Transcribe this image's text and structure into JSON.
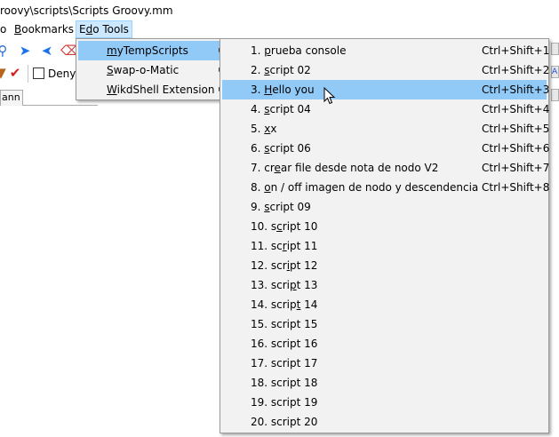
{
  "window": {
    "title": "roovy\\scripts\\Scripts Groovy.mm"
  },
  "menubar": {
    "items": [
      {
        "label": "o"
      },
      {
        "label": "Bookmarks",
        "mnemonic": "B",
        "rest": "ookmarks"
      },
      {
        "label": "Edo Tools",
        "pre": "E",
        "mnemonic": "d",
        "rest": "o Tools"
      }
    ]
  },
  "toolbar": {
    "deny_label": "Deny",
    "tab_label": "ann"
  },
  "edo_tools_menu": {
    "items": [
      {
        "pre": "",
        "mnemonic": "m",
        "rest": "yTempScripts",
        "submenu": true
      },
      {
        "pre": "",
        "mnemonic": "S",
        "rest": "wap-o-Matic",
        "submenu": true
      },
      {
        "pre": "",
        "mnemonic": "W",
        "rest": "ikdShell Extension",
        "submenu": true
      }
    ]
  },
  "scripts_menu": {
    "items": [
      {
        "pre": "1. ",
        "mnemonic": "p",
        "rest": "rueba console",
        "shortcut": "Ctrl+Shift+1"
      },
      {
        "pre": "2. ",
        "mnemonic": "s",
        "rest": "cript 02",
        "shortcut": "Ctrl+Shift+2"
      },
      {
        "pre": "3. ",
        "mnemonic": "H",
        "rest": "ello you",
        "shortcut": "Ctrl+Shift+3"
      },
      {
        "pre": "4. ",
        "mnemonic": "s",
        "rest": "cript 04",
        "shortcut": "Ctrl+Shift+4"
      },
      {
        "pre": "5. ",
        "mnemonic": "x",
        "rest": "x",
        "shortcut": "Ctrl+Shift+5"
      },
      {
        "pre": "6. ",
        "mnemonic": "s",
        "rest": "cript 06",
        "shortcut": "Ctrl+Shift+6"
      },
      {
        "pre": "7. cr",
        "mnemonic": "e",
        "rest": "ar file desde nota de nodo V2",
        "shortcut": "Ctrl+Shift+7"
      },
      {
        "pre": "8. ",
        "mnemonic": "o",
        "rest": "n / off imagen de nodo y descendencia",
        "shortcut": "Ctrl+Shift+8"
      },
      {
        "pre": "9. ",
        "mnemonic": "s",
        "rest": "cript 09",
        "shortcut": ""
      },
      {
        "pre": "10. s",
        "mnemonic": "c",
        "rest": "ript 10",
        "shortcut": ""
      },
      {
        "pre": "11. sc",
        "mnemonic": "r",
        "rest": "ipt 11",
        "shortcut": ""
      },
      {
        "pre": "12. scr",
        "mnemonic": "i",
        "rest": "pt 12",
        "shortcut": ""
      },
      {
        "pre": "13. scri",
        "mnemonic": "p",
        "rest": "t 13",
        "shortcut": ""
      },
      {
        "pre": "14. scrip",
        "mnemonic": "t",
        "rest": " 14",
        "shortcut": ""
      },
      {
        "pre": "15. script 15",
        "mnemonic": "",
        "rest": "",
        "shortcut": ""
      },
      {
        "pre": "16. script 16",
        "mnemonic": "",
        "rest": "",
        "shortcut": ""
      },
      {
        "pre": "17. script 17",
        "mnemonic": "",
        "rest": "",
        "shortcut": ""
      },
      {
        "pre": "18. script 18",
        "mnemonic": "",
        "rest": "",
        "shortcut": ""
      },
      {
        "pre": "19. script 19",
        "mnemonic": "",
        "rest": "",
        "shortcut": ""
      },
      {
        "pre": "20. script 20",
        "mnemonic": "",
        "rest": "",
        "shortcut": ""
      }
    ]
  },
  "colors": {
    "highlight": "#91c9f7",
    "menu_bg": "#f2f2f2",
    "menubar_open": "#cce8ff"
  },
  "icons": [
    "zoom-icon",
    "navigate-forward-icon",
    "navigate-back-icon",
    "filter-icon",
    "filter-clear-icon",
    "mouse-pointer-icon"
  ]
}
